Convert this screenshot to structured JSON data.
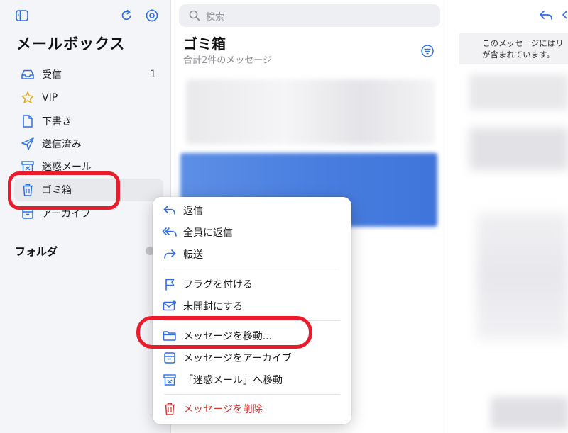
{
  "sidebar": {
    "title": "メールボックス",
    "mailboxes": [
      {
        "label": "受信",
        "count": "1",
        "icon": "inbox-icon"
      },
      {
        "label": "VIP",
        "count": "",
        "icon": "star-icon"
      },
      {
        "label": "下書き",
        "count": "",
        "icon": "document-icon"
      },
      {
        "label": "送信済み",
        "count": "",
        "icon": "paperplane-icon"
      },
      {
        "label": "迷惑メール",
        "count": "",
        "icon": "junk-icon"
      },
      {
        "label": "ゴミ箱",
        "count": "",
        "icon": "trash-icon",
        "selected": true
      },
      {
        "label": "アーカイブ",
        "count": "",
        "icon": "archive-icon"
      }
    ],
    "folders_title": "フォルダ"
  },
  "list": {
    "search_placeholder": "検索",
    "title": "ゴミ箱",
    "subtitle": "合計2件のメッセージ"
  },
  "detail": {
    "banner_line1": "このメッセージにはリ",
    "banner_line2": "が含まれています。"
  },
  "context_menu": {
    "items": [
      {
        "label": "返信",
        "icon": "reply-icon"
      },
      {
        "label": "全員に返信",
        "icon": "reply-all-icon"
      },
      {
        "label": "転送",
        "icon": "forward-icon"
      },
      {
        "label": "フラグを付ける",
        "icon": "flag-icon"
      },
      {
        "label": "未開封にする",
        "icon": "unread-envelope-icon"
      },
      {
        "label": "メッセージを移動...",
        "icon": "folder-icon"
      },
      {
        "label": "メッセージをアーカイブ",
        "icon": "archive-icon"
      },
      {
        "label": "「迷惑メール」へ移動",
        "icon": "junk-icon"
      },
      {
        "label": "メッセージを削除",
        "icon": "trash-icon",
        "destructive": true
      }
    ]
  },
  "colors": {
    "accent": "#2f6fe4",
    "destructive": "#e0362f",
    "highlight_annotation": "#ea1b2b"
  }
}
